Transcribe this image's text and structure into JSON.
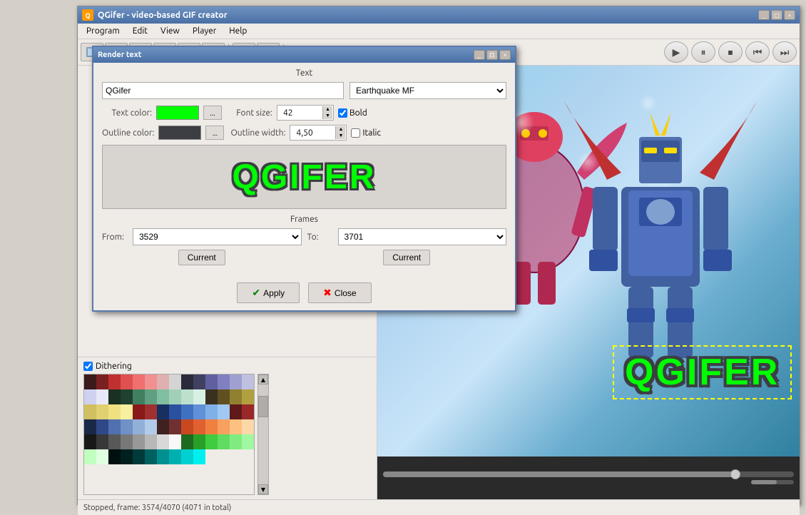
{
  "window": {
    "title": "QGifer - video-based GIF creator",
    "title_icon": "Q"
  },
  "menu": {
    "items": [
      "Program",
      "Edit",
      "View",
      "Player",
      "Help"
    ]
  },
  "toolbar": {
    "buttons": [
      "img1",
      "img2",
      "img3",
      "img4",
      "img5",
      "img6",
      "abc",
      "img7"
    ]
  },
  "playback": {
    "buttons": [
      "play",
      "pause",
      "stop",
      "prev",
      "next"
    ]
  },
  "dialog": {
    "title": "Render text",
    "sections": {
      "text_label": "Text",
      "text_value": "QGifer",
      "font_value": "Earthquake MF",
      "text_color_label": "Text color:",
      "text_color_value": "#00ff00",
      "font_size_label": "Font size:",
      "font_size_value": "42",
      "bold_label": "Bold",
      "bold_checked": true,
      "outline_color_label": "Outline color:",
      "outline_color_value": "#3c3e43",
      "outline_width_label": "Outline width:",
      "outline_width_value": "4,50",
      "italic_label": "Italic",
      "italic_checked": false,
      "preview_text": "QGIFER",
      "frames_label": "Frames",
      "from_label": "From:",
      "from_value": "3529",
      "to_label": "To:",
      "to_value": "3701",
      "current_btn_left": "Current",
      "current_btn_right": "Current",
      "apply_label": "Apply",
      "close_label": "Close",
      "dotted_btn": "..."
    }
  },
  "video_overlay": {
    "text": "QGIFER"
  },
  "dithering": {
    "label": "Dithering",
    "checked": true
  },
  "status": {
    "text": "Stopped, frame: 3574/4070 (4071 in total)"
  },
  "palette_colors": [
    "#3a1a1a",
    "#7a2020",
    "#c03030",
    "#e05050",
    "#f07070",
    "#f09090",
    "#e0b0b0",
    "#d4d4d4",
    "#2a2a3a",
    "#404060",
    "#6060a0",
    "#8080c0",
    "#a0a0d0",
    "#c0c0e0",
    "#d0d0f0",
    "#e8e8f8",
    "#1a3020",
    "#204030",
    "#408060",
    "#60a080",
    "#80c0a0",
    "#a0d0b8",
    "#bce0cc",
    "#d8f0e4",
    "#3a3020",
    "#605020",
    "#908030",
    "#b0a040",
    "#d0c060",
    "#e0d070",
    "#f0e080",
    "#f8f0a0",
    "#8a1a1a",
    "#a03030",
    "#183060",
    "#2a50a0",
    "#4070c0",
    "#6090d8",
    "#80b0e8",
    "#a0c8f0",
    "#601818",
    "#9a2828",
    "#1a2848",
    "#304888",
    "#5070b0",
    "#7090c8",
    "#90b0d8",
    "#b0cce8",
    "#402020",
    "#703030",
    "#c84820",
    "#e06030",
    "#f08040",
    "#f8a060",
    "#fcc080",
    "#fcd8a8",
    "#181818",
    "#383838",
    "#585858",
    "#787878",
    "#989898",
    "#b8b8b8",
    "#d8d8d8",
    "#f8f8f8",
    "#1e6a1e",
    "#28a028",
    "#40cc40",
    "#60dc60",
    "#80ec80",
    "#a0f8a0",
    "#c0ffc0",
    "#e0ffe0",
    "#001010",
    "#002020",
    "#003a3a",
    "#006060",
    "#009090",
    "#00b0b0",
    "#00d0d0",
    "#00f0f0"
  ]
}
